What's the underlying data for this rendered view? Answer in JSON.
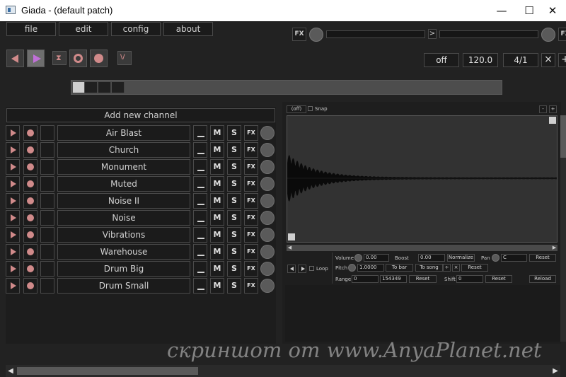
{
  "window": {
    "title": "Giada - (default patch)",
    "minimize": "—",
    "maximize": "☐",
    "close": "✕"
  },
  "menu": {
    "file": "file",
    "edit": "edit",
    "config": "config",
    "about": "about"
  },
  "top_fx": {
    "fx_left": "FX",
    "arrow": ">",
    "fx_right": "FX"
  },
  "transport": {
    "rewind": "◀",
    "play": "▶",
    "input_monitor": "⧗",
    "record_actions": "◉",
    "record_input": "●",
    "metronome": "\\/"
  },
  "timing": {
    "quantize": "off",
    "bpm": "120.0",
    "beats": "4/1",
    "close": "×",
    "plus": "+"
  },
  "channels": {
    "add_label": "Add new channel",
    "mute_label": "M",
    "solo_label": "S",
    "fx_label": "FX",
    "items": [
      "Air Blast",
      "Church",
      "Monument",
      "Muted",
      "Noise II",
      "Noise",
      "Vibrations",
      "Warehouse",
      "Drum Big",
      "Drum Small"
    ]
  },
  "editor": {
    "grid_value": "(off)",
    "snap_label": "Snap",
    "zoom_out": "-",
    "zoom_in": "+",
    "volume_label": "Volume",
    "volume_value": "0.00",
    "boost_label": "Boost",
    "boost_value": "0.00",
    "normalize_label": "Normalize",
    "pan_label": "Pan",
    "pan_value": "C",
    "reset_label": "Reset",
    "loop_label": "Loop",
    "pitch_label": "Pitch",
    "pitch_value": "1.0000",
    "to_bar_label": "To bar",
    "to_song_label": "To song",
    "half_label": "÷",
    "double_label": "×",
    "range_label": "Range",
    "range_start": "0",
    "range_end": "154349",
    "shift_label": "Shift",
    "shift_value": "0",
    "reload_label": "Reload"
  },
  "scroll": {
    "left": "◀",
    "right": "▶"
  },
  "watermark": "скриншот от www.AnyaPlanet.net"
}
